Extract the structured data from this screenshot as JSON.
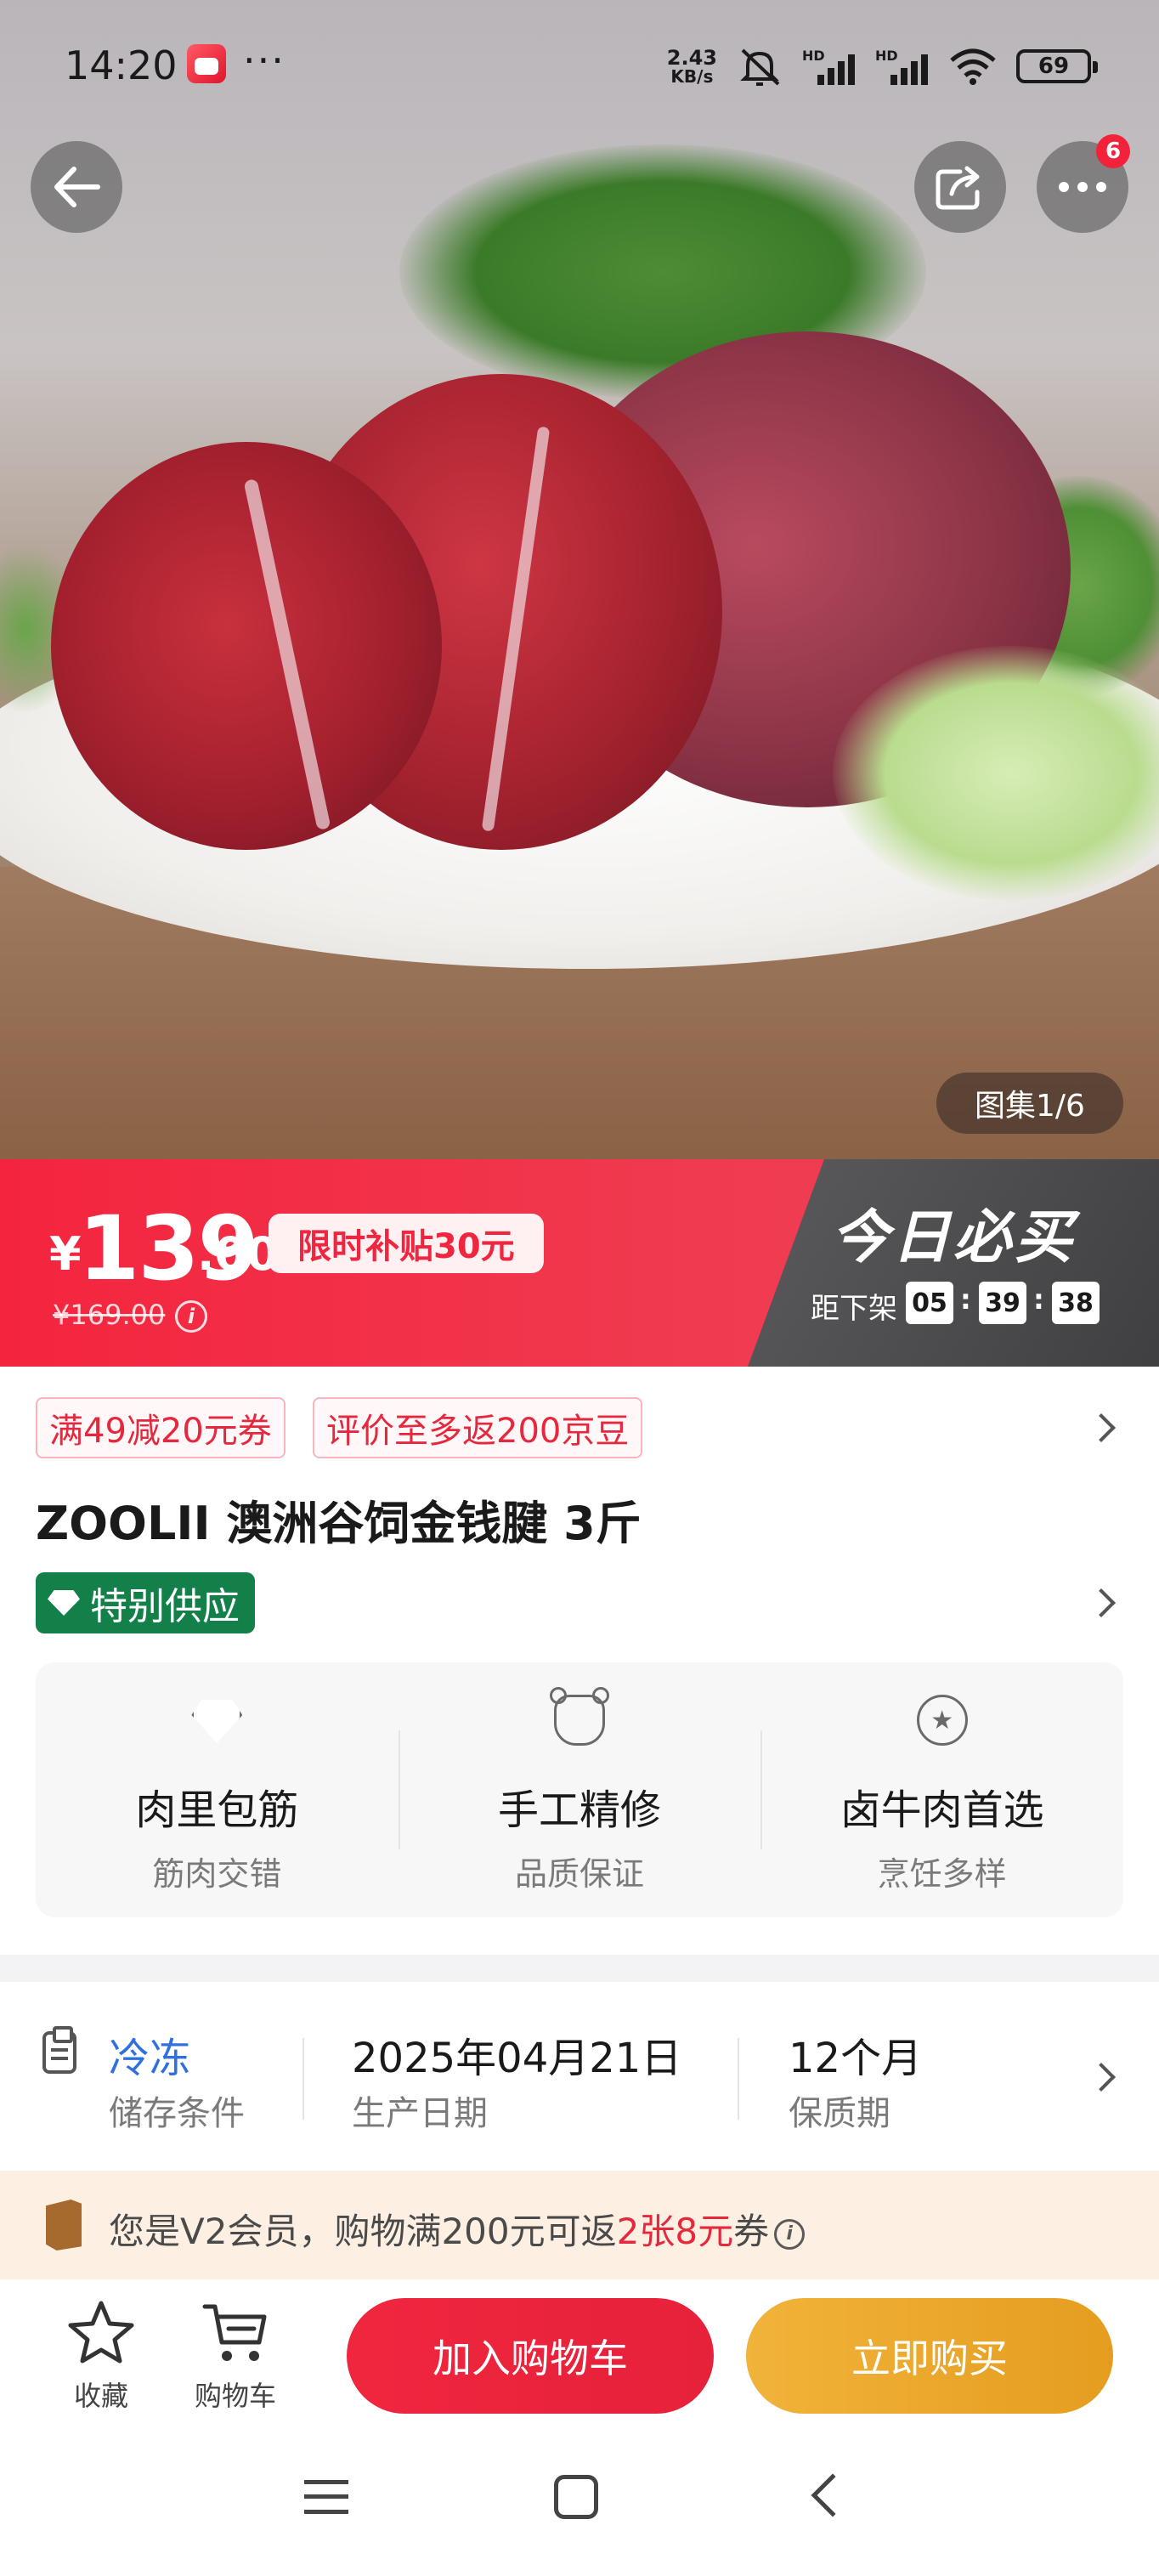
{
  "status_bar": {
    "time": "14:20",
    "more": "···",
    "net_speed_value": "2.43",
    "net_speed_unit": "KB/s",
    "hd": "HD",
    "battery": "69"
  },
  "nav": {
    "more_badge": "6",
    "gallery_counter": "图集1/6"
  },
  "price": {
    "currency": "¥",
    "integer": "139",
    "decimal": ".00",
    "subsidy": "限时补贴30元",
    "original": "¥169.00",
    "info_icon": "i",
    "promo_title": "今日必买",
    "countdown_label": "距下架",
    "countdown": {
      "h": "05",
      "m": "39",
      "s": "38",
      "sep": ":"
    }
  },
  "coupons": [
    "满49减20元券",
    "评价至多返200京豆"
  ],
  "product": {
    "title": "ZOOLII 澳洲谷饲金钱腱 3斤",
    "badge": "特别供应"
  },
  "features": [
    {
      "icon": "diamond-icon",
      "title": "肉里包筋",
      "subtitle": "筋肉交错"
    },
    {
      "icon": "cow-icon",
      "title": "手工精修",
      "subtitle": "品质保证"
    },
    {
      "icon": "medal-icon",
      "title": "卤牛肉首选",
      "subtitle": "烹饪多样"
    }
  ],
  "specs": [
    {
      "value": "冷冻",
      "label": "储存条件"
    },
    {
      "value": "2025年04月21日",
      "label": "生产日期"
    },
    {
      "value": "12个月",
      "label": "保质期"
    }
  ],
  "membership": {
    "prefix": "您是V2会员，购物满200元可返",
    "highlight": "2张8元",
    "suffix": "券",
    "info_icon": "i"
  },
  "actions": {
    "favorite_label": "收藏",
    "cart_label": "购物车",
    "add_to_cart": "加入购物车",
    "buy_now": "立即购买"
  },
  "colors": {
    "brand_red": "#f4243e",
    "buy_orange": "#e59d1f",
    "badge_green": "#13804a",
    "spec_blue": "#2f6fe0"
  }
}
